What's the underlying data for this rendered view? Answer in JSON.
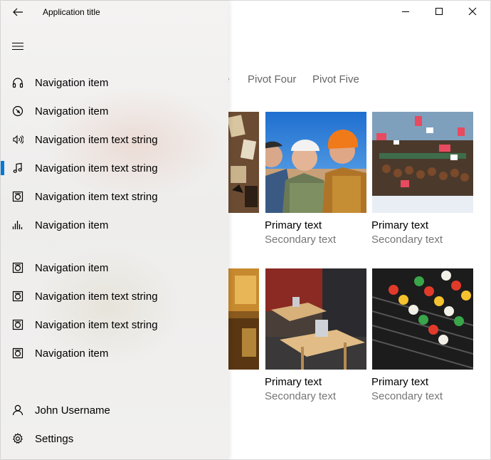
{
  "window": {
    "title": "Application title"
  },
  "colors": {
    "accent": "#0078d7",
    "secondary_text": "#767676",
    "pivot_text": "#666666"
  },
  "pivot": {
    "tabs": [
      {
        "label": "Pivot Four"
      },
      {
        "label": "Pivot Five"
      }
    ],
    "partial_tab_tail": "e"
  },
  "nav": {
    "items": [
      {
        "label": "Navigation item",
        "icon": "headphones-icon"
      },
      {
        "label": "Navigation item",
        "icon": "compass-icon"
      },
      {
        "label": "Navigation item text string",
        "icon": "speaker-icon"
      },
      {
        "label": "Navigation item text string",
        "icon": "music-note-icon",
        "selected": true
      },
      {
        "label": "Navigation item text string",
        "icon": "media-icon"
      },
      {
        "label": "Navigation item",
        "icon": "equalizer-icon"
      },
      {
        "label": "Navigation item",
        "icon": "media-icon"
      },
      {
        "label": "Navigation item text string",
        "icon": "media-icon"
      },
      {
        "label": "Navigation item text string",
        "icon": "media-icon"
      },
      {
        "label": "Navigation item",
        "icon": "media-icon"
      }
    ],
    "footer": [
      {
        "label": "John Username",
        "icon": "person-icon"
      },
      {
        "label": "Settings",
        "icon": "gear-icon"
      }
    ]
  },
  "grid": {
    "items": [
      {
        "primary": "Primary text",
        "secondary": "Secondary text"
      },
      {
        "primary": "Primary text",
        "secondary": "Secondary text"
      },
      {
        "primary": "Primary text",
        "secondary": "Secondary text"
      },
      {
        "primary": "Primary text",
        "secondary": "Secondary text"
      }
    ]
  }
}
